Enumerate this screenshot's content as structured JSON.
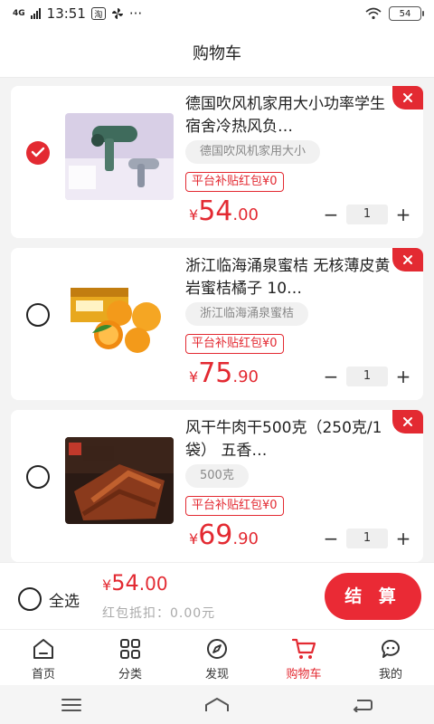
{
  "status_bar": {
    "network": "4G",
    "time": "13:51",
    "dots": "···",
    "battery": "54"
  },
  "header": {
    "title": "购物车"
  },
  "items": [
    {
      "title": "德国吹风机家用大小功率学生宿舍冷热风负…",
      "spec": "德国吹风机家用大小",
      "subsidy": "平台补贴红包¥0",
      "price_symbol": "¥",
      "price_int": "54",
      "price_dec": ".00",
      "quantity": "1",
      "checked": true
    },
    {
      "title": "浙江临海涌泉蜜桔 无核薄皮黄岩蜜桔橘子 10…",
      "spec": "浙江临海涌泉蜜桔",
      "subsidy": "平台补贴红包¥0",
      "price_symbol": "¥",
      "price_int": "75",
      "price_dec": ".90",
      "quantity": "1",
      "checked": false
    },
    {
      "title": "风干牛肉干500克（250克/1袋） 五香…",
      "spec": "500克",
      "subsidy": "平台补贴红包¥0",
      "price_symbol": "¥",
      "price_int": "69",
      "price_dec": ".90",
      "quantity": "1",
      "checked": false
    }
  ],
  "stepper": {
    "minus": "−",
    "plus": "+"
  },
  "checkout": {
    "select_all": "全选",
    "total_symbol": "¥",
    "total_int": "54",
    "total_dec": ".00",
    "deduction": "红包抵扣：0.00元",
    "button": "结 算"
  },
  "tabs": [
    {
      "label": "首页",
      "icon": "home-icon"
    },
    {
      "label": "分类",
      "icon": "category-icon"
    },
    {
      "label": "发现",
      "icon": "compass-icon"
    },
    {
      "label": "购物车",
      "icon": "cart-icon",
      "active": true
    },
    {
      "label": "我的",
      "icon": "profile-icon"
    }
  ],
  "colors": {
    "accent": "#e32a32",
    "background": "#f3f3f3"
  }
}
